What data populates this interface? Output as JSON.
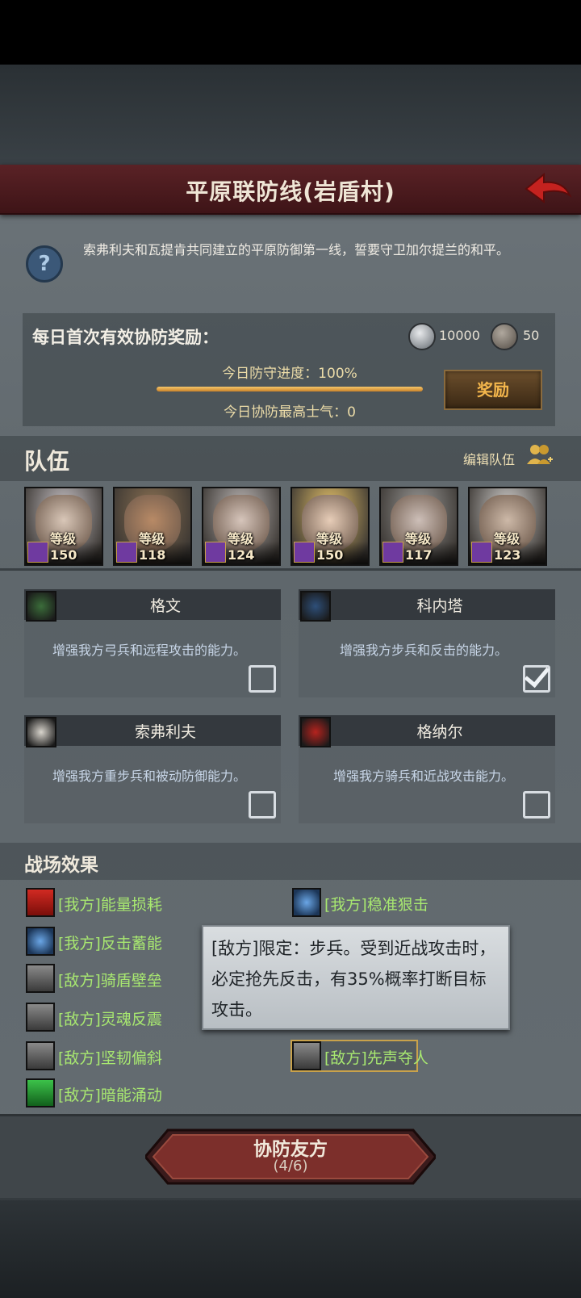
{
  "header": {
    "title": "平原联防线(岩盾村)"
  },
  "intro": {
    "description": "索弗利夫和瓦提肯共同建立的平原防御第一线，誓要守卫加尔提兰的和平。"
  },
  "reward": {
    "title": "每日首次有效协防奖励：",
    "currency1_amount": "10000",
    "currency2_amount": "50",
    "progress_label": "今日防守进度：100%",
    "progress_fraction": 1.0,
    "morale_label": "今日协防最高士气：0",
    "button_label": "奖励"
  },
  "team": {
    "label": "队伍",
    "edit_label": "编辑队伍",
    "heroes": [
      {
        "level_text": "等级150",
        "skin": "#d9c7b8",
        "hair": "#c9c4c8"
      },
      {
        "level_text": "等级118",
        "skin": "#b88a66",
        "hair": "#8b7153"
      },
      {
        "level_text": "等级124",
        "skin": "#d6c5bb",
        "hair": "#bdb8b7"
      },
      {
        "level_text": "等级150",
        "skin": "#e7cdb8",
        "hair": "#e8c46a"
      },
      {
        "level_text": "等级117",
        "skin": "#cdbfb8",
        "hair": "#9b9a98"
      },
      {
        "level_text": "等级123",
        "skin": "#cdb9a8",
        "hair": "#d4d2d0"
      }
    ]
  },
  "commanders": [
    {
      "name": "格文",
      "description": "增强我方弓兵和远程攻击的能力。",
      "checked": false,
      "icon": "tree-icon",
      "color": "#3b6d3a"
    },
    {
      "name": "科内塔",
      "description": "增强我方步兵和反击的能力。",
      "checked": true,
      "icon": "blue-flame-icon",
      "color": "#2e4f79"
    },
    {
      "name": "索弗利夫",
      "description": "增强我方重步兵和被动防御能力。",
      "checked": false,
      "icon": "skull-helmet-icon",
      "color": "#d8d4cc"
    },
    {
      "name": "格纳尔",
      "description": "增强我方骑兵和近战攻击能力。",
      "checked": false,
      "icon": "red-sigil-icon",
      "color": "#b5231e"
    }
  ],
  "effects": {
    "label": "战场效果",
    "left": [
      {
        "text": "[我方]能量损耗",
        "icon": "red-down-arrow-icon"
      },
      {
        "text": "[我方]反击蓄能",
        "icon": "blue-flame-icon"
      },
      {
        "text": "[敌方]骑盾壁垒",
        "icon": "pillar-icon"
      },
      {
        "text": "[敌方]灵魂反震",
        "icon": "pillar-icon"
      },
      {
        "text": "[敌方]坚韧偏斜",
        "icon": "pillar-icon"
      },
      {
        "text": "[敌方]暗能涌动",
        "icon": "green-up-arrow-icon"
      }
    ],
    "right": [
      {
        "text": "[我方]稳准狠击",
        "icon": "blue-flame-icon"
      },
      {
        "text": "[敌方]先声夺人",
        "icon": "pillar-icon"
      }
    ]
  },
  "tooltip": {
    "text": "[敌方]限定：步兵。受到近战攻击时，必定抢先反击，有35%概率打断目标攻击。"
  },
  "assist": {
    "label": "协防友方",
    "count": "(4/6)"
  }
}
